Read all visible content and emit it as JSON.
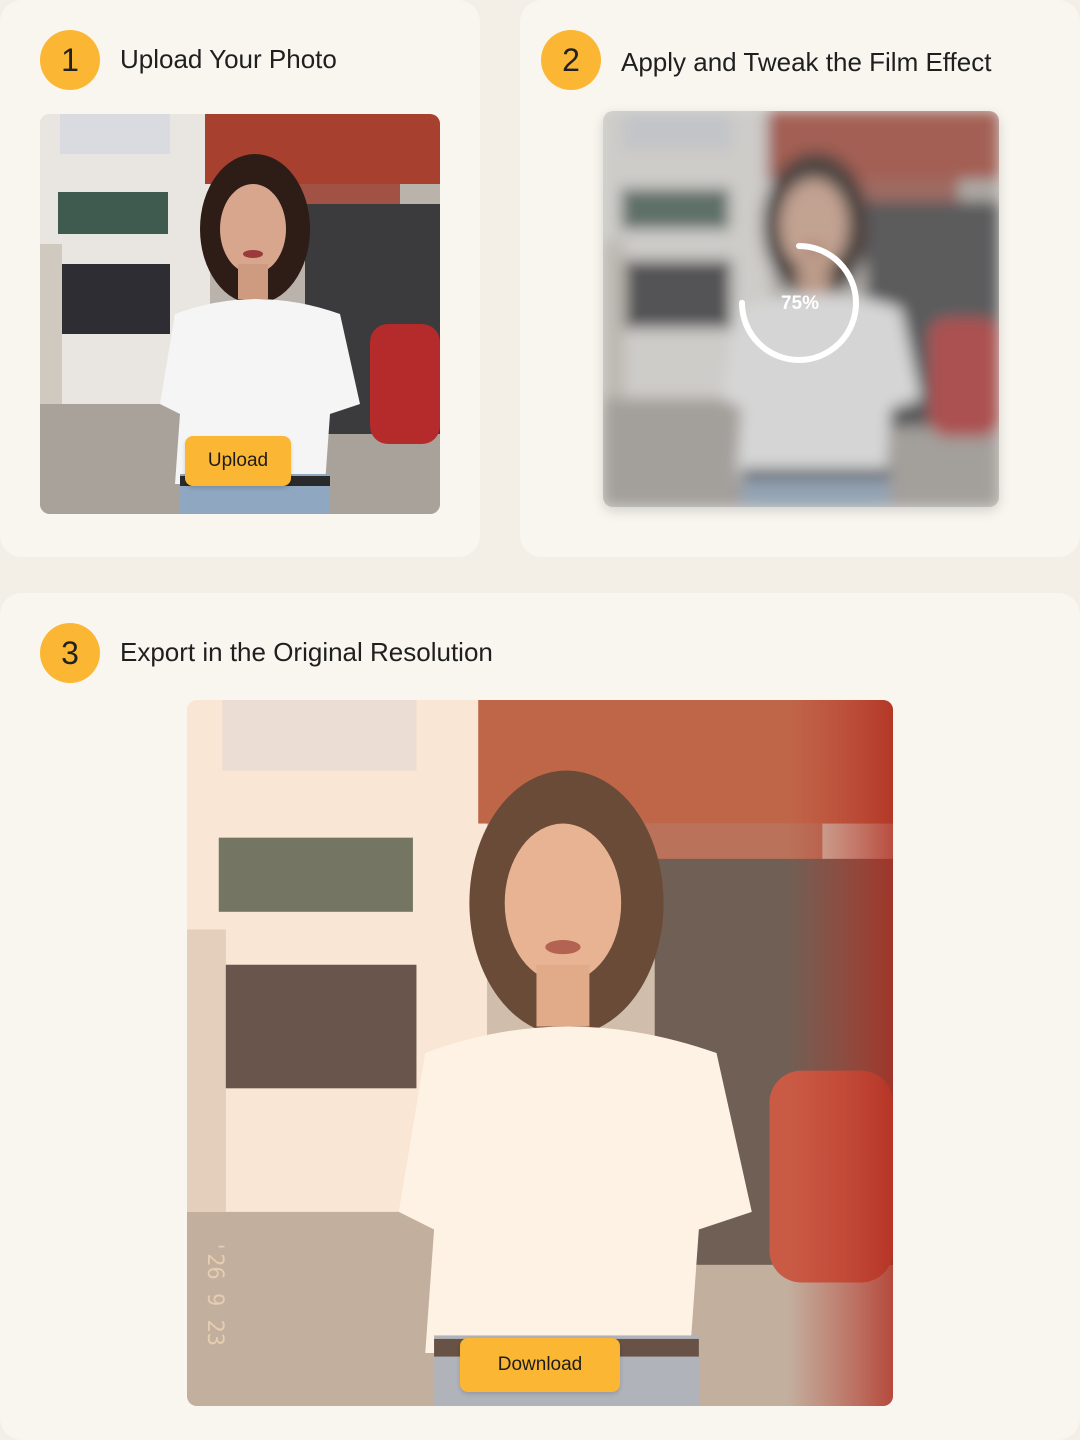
{
  "steps": [
    {
      "number": "1",
      "title": "Upload Your Photo",
      "button_label": "Upload"
    },
    {
      "number": "2",
      "title": "Apply and Tweak the Film Effect",
      "progress_label": "75%",
      "progress_value": 0.75
    },
    {
      "number": "3",
      "title": "Export in the Original Resolution",
      "button_label": "Download",
      "date_stamp": "'26 9 23"
    }
  ],
  "colors": {
    "accent": "#fbb733",
    "page_background": "#f4efe6",
    "card_background": "#f8f6ef"
  },
  "icons": [
    "photo-placeholder",
    "progress-ring"
  ]
}
